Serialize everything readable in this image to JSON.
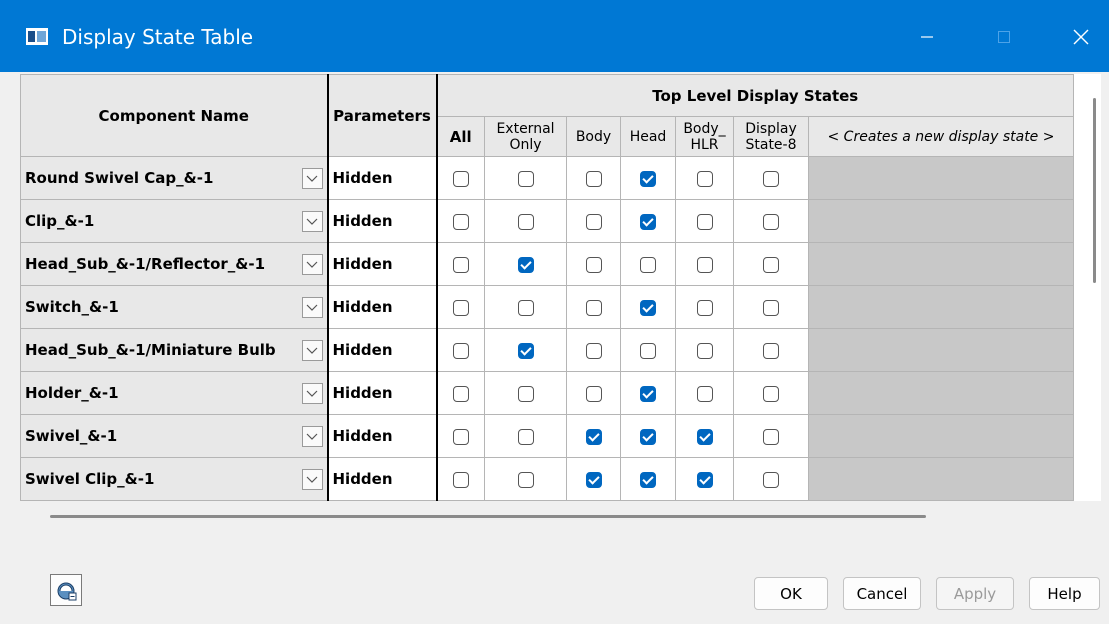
{
  "window": {
    "title": "Display State Table"
  },
  "header": {
    "component_name": "Component Name",
    "parameters": "Parameters",
    "top_level": "Top Level Display States",
    "cols": [
      {
        "l1": "All",
        "l2": ""
      },
      {
        "l1": "External",
        "l2": "Only"
      },
      {
        "l1": "Body",
        "l2": ""
      },
      {
        "l1": "Head",
        "l2": ""
      },
      {
        "l1": "Body_",
        "l2": "HLR"
      },
      {
        "l1": "Display",
        "l2": "State-8"
      }
    ],
    "new_state": "< Creates a new display state >"
  },
  "rows": [
    {
      "name": "Round Swivel Cap_&-1",
      "param": "Hidden",
      "checks": [
        false,
        false,
        false,
        true,
        false,
        false
      ]
    },
    {
      "name": "Clip_&-1",
      "param": "Hidden",
      "checks": [
        false,
        false,
        false,
        true,
        false,
        false
      ]
    },
    {
      "name": "Head_Sub_&-1/Reflector_&-1",
      "param": "Hidden",
      "checks": [
        false,
        true,
        false,
        false,
        false,
        false
      ]
    },
    {
      "name": "Switch_&-1",
      "param": "Hidden",
      "checks": [
        false,
        false,
        false,
        true,
        false,
        false
      ]
    },
    {
      "name": "Head_Sub_&-1/Miniature Bulb",
      "param": "Hidden",
      "checks": [
        false,
        true,
        false,
        false,
        false,
        false
      ]
    },
    {
      "name": "Holder_&-1",
      "param": "Hidden",
      "checks": [
        false,
        false,
        false,
        true,
        false,
        false
      ]
    },
    {
      "name": "Swivel_&-1",
      "param": "Hidden",
      "checks": [
        false,
        false,
        true,
        true,
        true,
        false
      ]
    },
    {
      "name": "Swivel Clip_&-1",
      "param": "Hidden",
      "checks": [
        false,
        false,
        true,
        true,
        true,
        false
      ]
    }
  ],
  "buttons": {
    "ok": "OK",
    "cancel": "Cancel",
    "apply": "Apply",
    "help": "Help"
  },
  "colors": {
    "titlebar": "#0078d4",
    "checked": "#0067c0",
    "unused_column": "#c8c8c8"
  }
}
